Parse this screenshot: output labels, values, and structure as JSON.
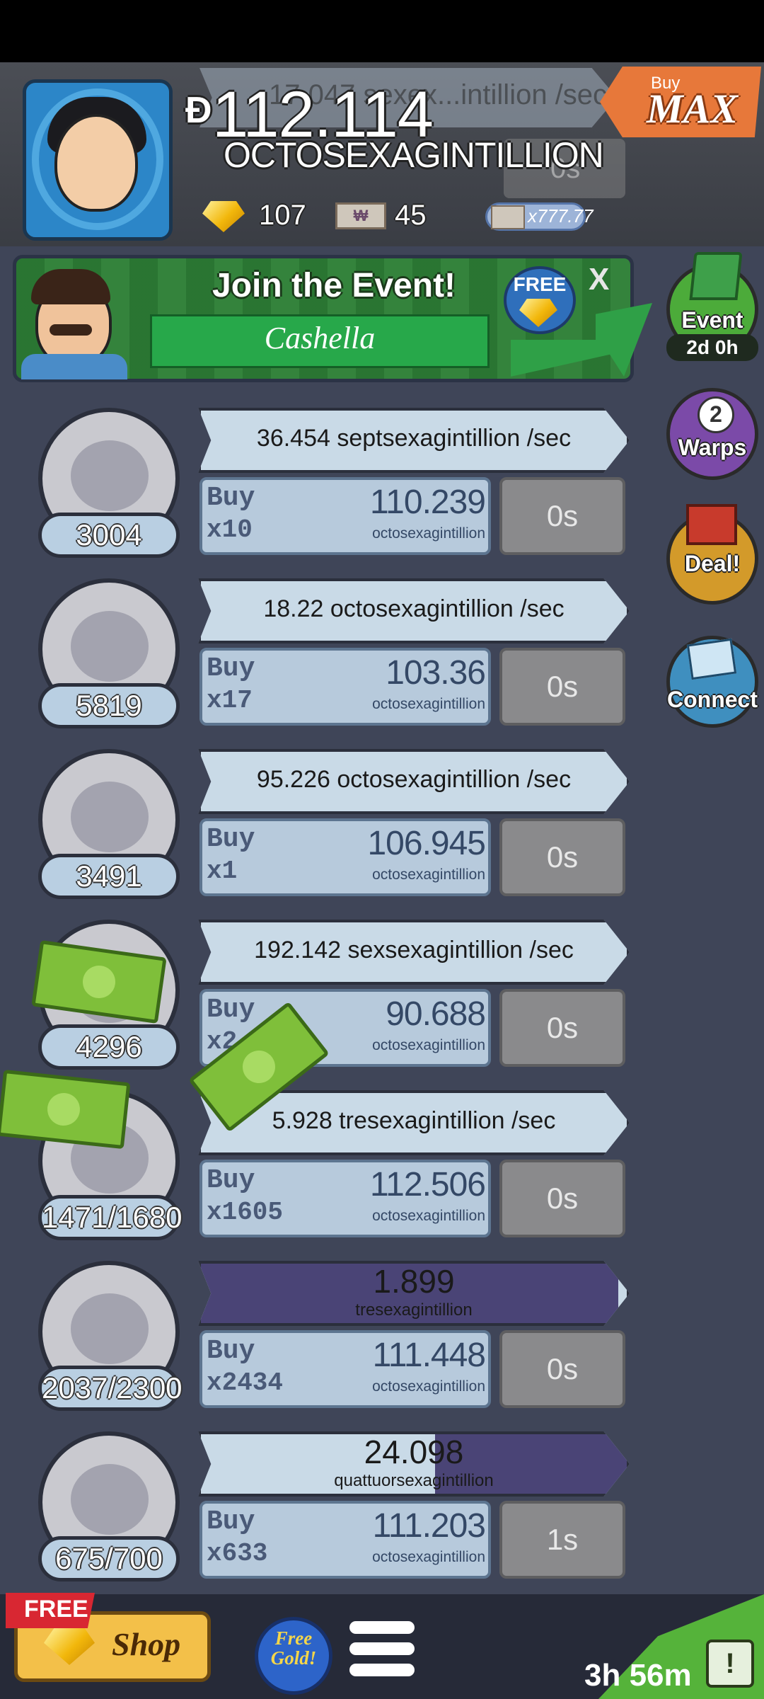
{
  "header": {
    "currency_symbol": "Ɖ",
    "money_value": "112.114",
    "money_unit": "OCTOSEXAGINTILLION",
    "ghost_rate_text": "17.047 sexex...intillion /sec",
    "ghost_timer_text": "0s",
    "gold_count": "107",
    "megabucks_count": "45",
    "multiplier_badge": "x777.77",
    "buy_max_small": "Buy",
    "buy_max_big": "MAX"
  },
  "event_banner": {
    "title": "Join the Event!",
    "name": "Cashella",
    "free_label": "FREE",
    "close_label": "X"
  },
  "side_buttons": {
    "event_label": "Event",
    "event_timer": "2d 0h",
    "warps_count": "2",
    "warps_label": "Warps",
    "deal_label": "Deal!",
    "connect_label": "Connect"
  },
  "businesses": [
    {
      "count": "3004",
      "rate": "36.454 septsexagintillion /sec",
      "buy_word": "Buy",
      "buy_qty": "x10",
      "cost": "110.239",
      "cost_unit": "octosexagintillion",
      "timer": "0s",
      "icon": "rocket-moon-icon",
      "progress": 0
    },
    {
      "count": "5819",
      "rate": "18.22 octosexagintillion /sec",
      "buy_word": "Buy",
      "buy_qty": "x17",
      "cost": "103.36",
      "cost_unit": "octosexagintillion",
      "timer": "0s",
      "icon": "cocktail-glass-icon",
      "progress": 0
    },
    {
      "count": "3491",
      "rate": "95.226 octosexagintillion /sec",
      "buy_word": "Buy",
      "buy_qty": "x1",
      "cost": "106.945",
      "cost_unit": "octosexagintillion",
      "timer": "0s",
      "icon": "barn-icon",
      "progress": 0
    },
    {
      "count": "4296",
      "rate": "192.142 sexsexagintillion /sec",
      "buy_word": "Buy",
      "buy_qty": "x2",
      "cost": "90.688",
      "cost_unit": "octosexagintillion",
      "timer": "0s",
      "icon": "business-icon",
      "progress": 0
    },
    {
      "count": "1471/1680",
      "rate": "5.928 tresexagintillion /sec",
      "buy_word": "Buy",
      "buy_qty": "x1605",
      "cost": "112.506",
      "cost_unit": "octosexagintillion",
      "timer": "0s",
      "icon": "amusement-park-icon",
      "progress": 0
    },
    {
      "count": "2037/2300",
      "rate_value": "1.899",
      "rate_unit": "tresexagintillion",
      "buy_word": "Buy",
      "buy_qty": "x2434",
      "cost": "111.448",
      "cost_unit": "octosexagintillion",
      "timer": "0s",
      "icon": "werewolf-icon",
      "progress": 0.98
    },
    {
      "count": "675/700",
      "rate_value": "24.098",
      "rate_unit": "quattuorsexagintillion",
      "buy_word": "Buy",
      "buy_qty": "x633",
      "cost": "111.203",
      "cost_unit": "octosexagintillion",
      "timer": "1s",
      "icon": "ray-gun-icon",
      "progress": 0.45
    }
  ],
  "bottom_bar": {
    "free_tag": "FREE",
    "shop_label": "Shop",
    "free_gold_label": "Free Gold!",
    "tv_timer": "3h 56m",
    "tv_icon_glyph": "!"
  },
  "colors": {
    "background": "#3f4558",
    "rate_ribbon": "#c9dae7",
    "buy_box": "#b7cadc",
    "timer_box": "#8a8a8c",
    "progress_fill": "#4a4476",
    "event_green": "#2d7f36",
    "buy_max_orange": "#e7783a"
  }
}
